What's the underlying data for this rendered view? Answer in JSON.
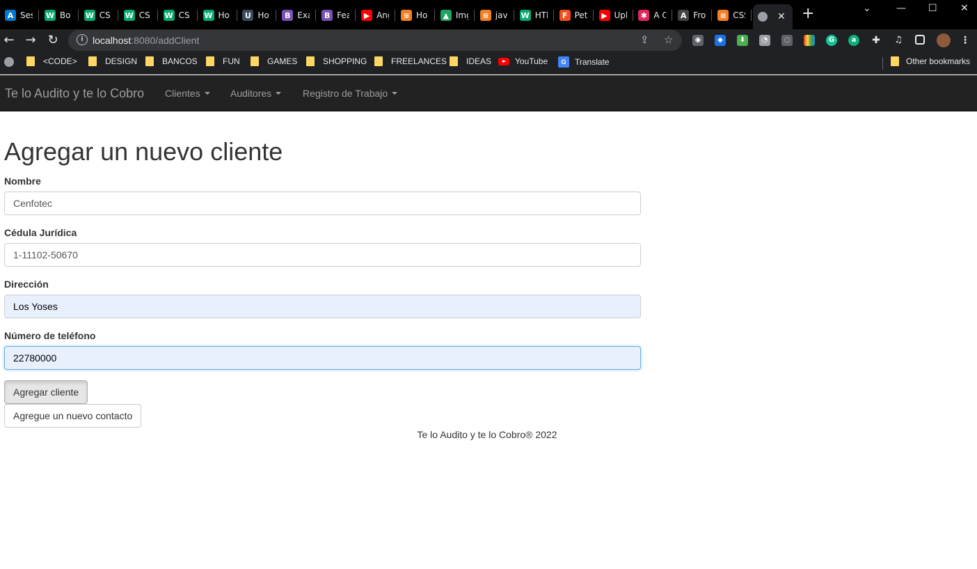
{
  "browser": {
    "tabs": [
      {
        "title": "Ses",
        "icon": "azure-icon",
        "color": "#0078d4",
        "glyph": "A"
      },
      {
        "title": "Bo",
        "icon": "w3schools-icon",
        "color": "#04aa6d",
        "glyph": "W"
      },
      {
        "title": "CS",
        "icon": "w3schools-icon",
        "color": "#04aa6d",
        "glyph": "W"
      },
      {
        "title": "CS",
        "icon": "w3schools-icon",
        "color": "#04aa6d",
        "glyph": "W"
      },
      {
        "title": "CS",
        "icon": "w3schools-icon",
        "color": "#04aa6d",
        "glyph": "W"
      },
      {
        "title": "Ho",
        "icon": "w3schools-icon",
        "color": "#04aa6d",
        "glyph": "W"
      },
      {
        "title": "Ho",
        "icon": "ui-icon",
        "color": "#3b4c5c",
        "glyph": "U"
      },
      {
        "title": "Exa",
        "icon": "bootstrap-icon",
        "color": "#7952b3",
        "glyph": "B"
      },
      {
        "title": "Fea",
        "icon": "bootstrap-icon",
        "color": "#7952b3",
        "glyph": "B"
      },
      {
        "title": "Ang",
        "icon": "youtube-icon",
        "color": "#ff0000",
        "glyph": "▶"
      },
      {
        "title": "Ho",
        "icon": "stackoverflow-icon",
        "color": "#f48024",
        "glyph": "≡"
      },
      {
        "title": "Img",
        "icon": "drive-icon",
        "color": "#1fa463",
        "glyph": "▲"
      },
      {
        "title": "java",
        "icon": "stackoverflow-icon",
        "color": "#f48024",
        "glyph": "≡"
      },
      {
        "title": "HTI",
        "icon": "w3schools-icon",
        "color": "#04aa6d",
        "glyph": "W"
      },
      {
        "title": "Pet",
        "icon": "figma-icon",
        "color": "#f24e1e",
        "glyph": "F"
      },
      {
        "title": "Upl",
        "icon": "youtube-icon",
        "color": "#ff0000",
        "glyph": "▶"
      },
      {
        "title": "A C",
        "icon": "asterisk-icon",
        "color": "#e0245e",
        "glyph": "✱"
      },
      {
        "title": "Fro",
        "icon": "angular-icon",
        "color": "#444444",
        "glyph": "A"
      },
      {
        "title": "CSS",
        "icon": "stackoverflow-icon",
        "color": "#f48024",
        "glyph": "≡"
      }
    ],
    "active_tab_close": "✕",
    "new_tab": "+",
    "url_host": "localhost",
    "url_rest": ":8080/addClient",
    "bookmarks": [
      {
        "label": "<CODE>",
        "type": "folder"
      },
      {
        "label": "DESIGN",
        "type": "folder"
      },
      {
        "label": "BANCOS",
        "type": "folder"
      },
      {
        "label": "FUN",
        "type": "folder"
      },
      {
        "label": "GAMES",
        "type": "folder"
      },
      {
        "label": "SHOPPING",
        "type": "folder"
      },
      {
        "label": "FREELANCES",
        "type": "folder"
      },
      {
        "label": "IDEAS",
        "type": "folder"
      },
      {
        "label": "YouTube",
        "type": "youtube"
      },
      {
        "label": "Translate",
        "type": "translate"
      }
    ],
    "other_bookmarks": "Other bookmarks"
  },
  "navbar": {
    "brand": "Te lo Audito y te lo Cobro",
    "menus": [
      "Clientes",
      "Auditores",
      "Registro de Trabajo"
    ]
  },
  "form": {
    "title": "Agregar un nuevo cliente",
    "fields": [
      {
        "label": "Nombre",
        "value": "Cenfotec"
      },
      {
        "label": "Cédula Jurídica",
        "value": "1-11102-50670"
      },
      {
        "label": "Dirección",
        "value": "Los Yoses"
      },
      {
        "label": "Número de teléfono",
        "value": "22780000"
      }
    ],
    "submit_label": "Agregar cliente",
    "add_contact_label": "Agregue un nuevo contacto"
  },
  "footer": {
    "text": "Te lo Audito y te lo Cobro® 2022"
  },
  "colors": {
    "navbar_bg": "#222222",
    "navbar_text": "#9d9d9d",
    "autofill_bg": "#e8f0fe",
    "focus_border": "#66afe9"
  }
}
